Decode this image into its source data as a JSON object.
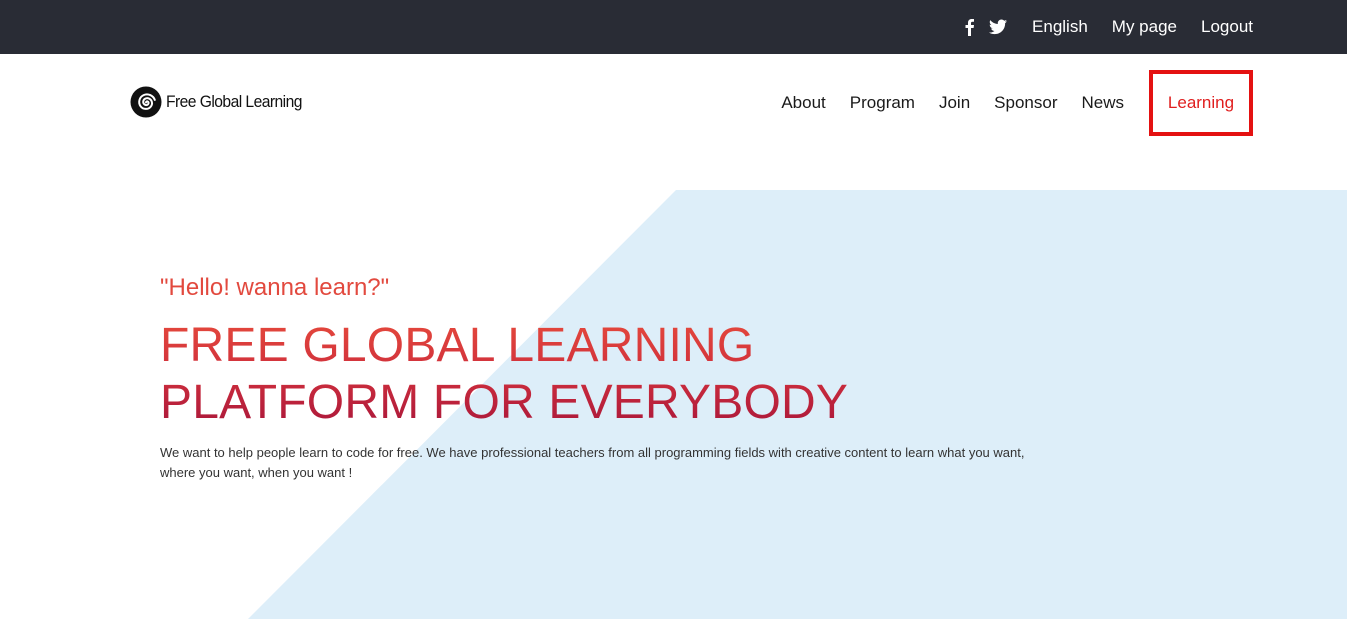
{
  "topbar": {
    "icons": [
      "facebook-icon",
      "twitter-icon"
    ],
    "links": [
      "English",
      "My page",
      "Logout"
    ]
  },
  "navbar": {
    "logo_text": "Free Global Learning",
    "menu": [
      "About",
      "Program",
      "Join",
      "Sponsor",
      "News",
      "Learning"
    ],
    "highlighted_item": "Learning"
  },
  "hero": {
    "tagline": "\"Hello! wanna learn?\"",
    "headline_line1": "FREE GLOBAL LEARNING",
    "headline_line2": "PLATFORM FOR EVERYBODY",
    "description": "We want to help people learn to code for free. We have professional teachers from all programming fields with creative content to learn what you want, where you want, when you want !"
  },
  "colors": {
    "topbar_bg": "#292c35",
    "accent_red": "#e2493e",
    "highlight_border": "#e41111",
    "hero_shape": "#ddeef9"
  }
}
